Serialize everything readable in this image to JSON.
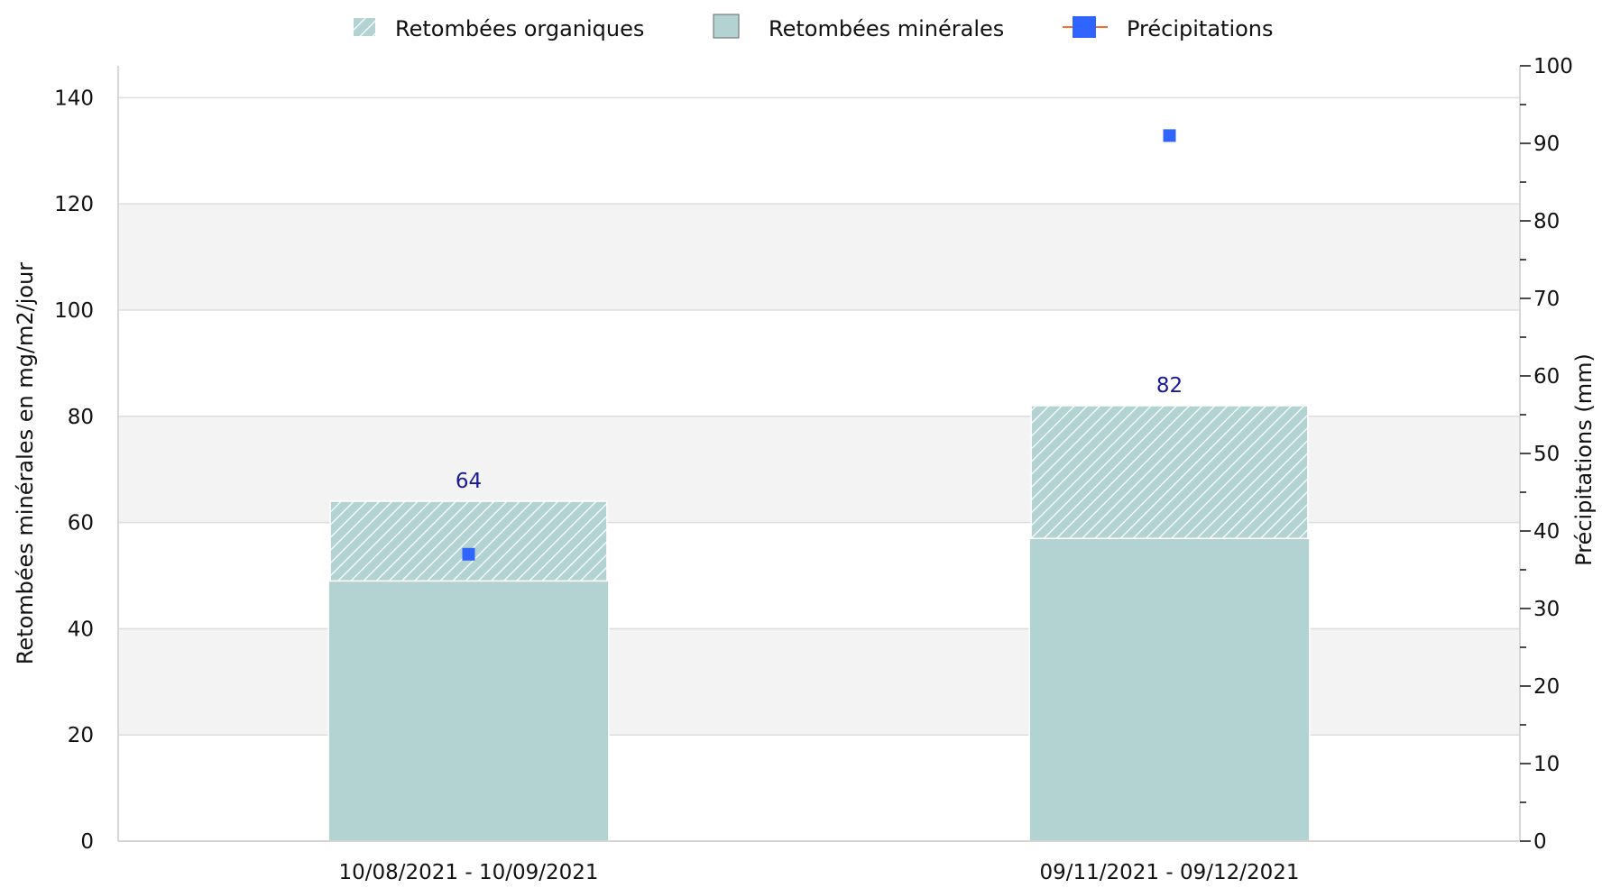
{
  "legend": {
    "organic_label": "Retombées organiques",
    "mineral_label": "Retombées minérales",
    "precip_label": "Précipitations"
  },
  "chart_data": {
    "type": "bar",
    "categories": [
      "10/08/2021 - 10/09/2021",
      "09/11/2021 - 09/12/2021"
    ],
    "series": [
      {
        "name": "Retombées minérales",
        "values": [
          49,
          57
        ],
        "color": "#b3d3d3",
        "axis": "left",
        "stack": "total"
      },
      {
        "name": "Retombées organiques",
        "values": [
          15,
          25
        ],
        "color": "#b3d3d3",
        "pattern": "hatched",
        "axis": "left",
        "stack": "total"
      },
      {
        "name": "Précipitations",
        "values": [
          37,
          91
        ],
        "color": "#2f64ff",
        "type": "scatter",
        "marker": "square",
        "axis": "right"
      }
    ],
    "totals": [
      64,
      82
    ],
    "total_label_color": "#1a1a99",
    "left_axis": {
      "label": "Retombées minérales en mg/m2/jour",
      "ylim": [
        0,
        146
      ],
      "ticks": [
        0,
        20,
        40,
        60,
        80,
        100,
        120,
        140
      ]
    },
    "right_axis": {
      "label": "Précipitations (mm)",
      "ylim": [
        0,
        100
      ],
      "ticks": [
        0,
        10,
        20,
        30,
        40,
        50,
        60,
        70,
        80,
        90,
        100
      ]
    },
    "grid": true,
    "legend_position": "top"
  }
}
